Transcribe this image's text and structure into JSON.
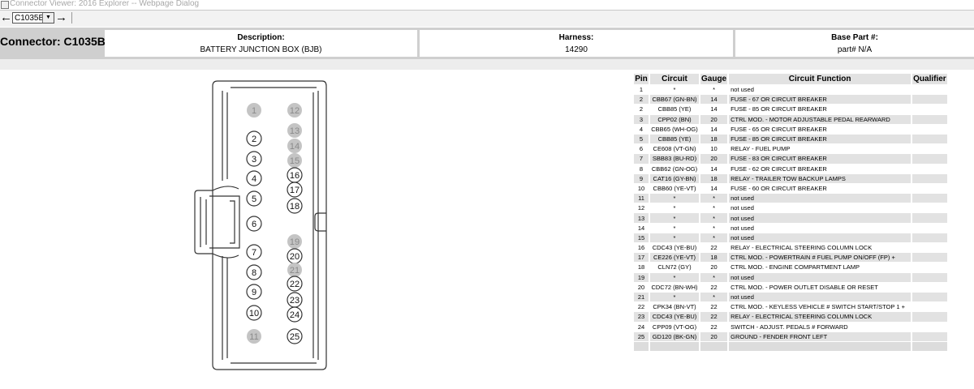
{
  "window": {
    "title": "Connector Viewer: 2016 Explorer -- Webpage Dialog"
  },
  "nav": {
    "back_icon": "←",
    "forward_icon": "→",
    "selected_connector": "C1035B",
    "dropdown_icon": "▼"
  },
  "header": {
    "connector_label": "Connector: C1035B",
    "description_label": "Description:",
    "description_value": "BATTERY JUNCTION BOX (BJB)",
    "harness_label": "Harness:",
    "harness_value": "14290",
    "base_part_label": "Base Part #:",
    "base_part_value": "part# N/A"
  },
  "diagram": {
    "pins": [
      {
        "n": "1",
        "used": false
      },
      {
        "n": "2",
        "used": true
      },
      {
        "n": "3",
        "used": true
      },
      {
        "n": "4",
        "used": true
      },
      {
        "n": "5",
        "used": true
      },
      {
        "n": "6",
        "used": true
      },
      {
        "n": "7",
        "used": true
      },
      {
        "n": "8",
        "used": true
      },
      {
        "n": "9",
        "used": true
      },
      {
        "n": "10",
        "used": true
      },
      {
        "n": "11",
        "used": false
      },
      {
        "n": "12",
        "used": false
      },
      {
        "n": "13",
        "used": false
      },
      {
        "n": "14",
        "used": false
      },
      {
        "n": "15",
        "used": false
      },
      {
        "n": "16",
        "used": true
      },
      {
        "n": "17",
        "used": true
      },
      {
        "n": "18",
        "used": true
      },
      {
        "n": "19",
        "used": false
      },
      {
        "n": "20",
        "used": true
      },
      {
        "n": "21",
        "used": false
      },
      {
        "n": "22",
        "used": true
      },
      {
        "n": "23",
        "used": true
      },
      {
        "n": "24",
        "used": true
      },
      {
        "n": "25",
        "used": true
      }
    ],
    "colors": {
      "unused_fill": "#c4c4c4",
      "used_fill": "#ffffff",
      "outline": "#333333"
    }
  },
  "table": {
    "headers": [
      "Pin",
      "Circuit",
      "Gauge",
      "Circuit Function",
      "Qualifier"
    ],
    "rows": [
      [
        "1",
        "*",
        "*",
        "not used",
        ""
      ],
      [
        "2",
        "CBB67 (GN-BN)",
        "14",
        "FUSE - 67 OR CIRCUIT BREAKER",
        ""
      ],
      [
        "2",
        "CBB85 (YE)",
        "14",
        "FUSE - 85 OR CIRCUIT BREAKER",
        ""
      ],
      [
        "3",
        "CPP02 (BN)",
        "20",
        "CTRL MOD. - MOTOR ADJUSTABLE PEDAL REARWARD",
        ""
      ],
      [
        "4",
        "CBB65 (WH-OG)",
        "14",
        "FUSE - 65 OR CIRCUIT BREAKER",
        ""
      ],
      [
        "5",
        "CBB85 (YE)",
        "18",
        "FUSE - 85 OR CIRCUIT BREAKER",
        ""
      ],
      [
        "6",
        "CE608 (VT-GN)",
        "10",
        "RELAY - FUEL PUMP",
        ""
      ],
      [
        "7",
        "SBB83 (BU-RD)",
        "20",
        "FUSE - 83 OR CIRCUIT BREAKER",
        ""
      ],
      [
        "8",
        "CBB62 (GN-OG)",
        "14",
        "FUSE - 62 OR CIRCUIT BREAKER",
        ""
      ],
      [
        "9",
        "CAT16 (GY-BN)",
        "18",
        "RELAY - TRAILER TOW BACKUP LAMPS",
        ""
      ],
      [
        "10",
        "CBB60 (YE-VT)",
        "14",
        "FUSE - 60 OR CIRCUIT BREAKER",
        ""
      ],
      [
        "11",
        "*",
        "*",
        "not used",
        ""
      ],
      [
        "12",
        "*",
        "*",
        "not used",
        ""
      ],
      [
        "13",
        "*",
        "*",
        "not used",
        ""
      ],
      [
        "14",
        "*",
        "*",
        "not used",
        ""
      ],
      [
        "15",
        "*",
        "*",
        "not used",
        ""
      ],
      [
        "16",
        "CDC43 (YE-BU)",
        "22",
        "RELAY - ELECTRICAL STEERING COLUMN LOCK",
        ""
      ],
      [
        "17",
        "CE226 (YE-VT)",
        "18",
        "CTRL MOD. - POWERTRAIN # FUEL PUMP ON/OFF (FP) +",
        ""
      ],
      [
        "18",
        "CLN72 (GY)",
        "20",
        "CTRL MOD. - ENGINE COMPARTMENT LAMP",
        ""
      ],
      [
        "19",
        "*",
        "*",
        "not used",
        ""
      ],
      [
        "20",
        "CDC72 (BN-WH)",
        "22",
        "CTRL MOD. - POWER OUTLET DISABLE OR RESET",
        ""
      ],
      [
        "21",
        "*",
        "*",
        "not used",
        ""
      ],
      [
        "22",
        "CPK34 (BN-VT)",
        "22",
        "CTRL MOD. - KEYLESS VEHICLE # SWITCH START/STOP 1 +",
        ""
      ],
      [
        "23",
        "CDC43 (YE-BU)",
        "22",
        "RELAY - ELECTRICAL STEERING COLUMN LOCK",
        ""
      ],
      [
        "24",
        "CPP09 (VT-OG)",
        "22",
        "SWITCH - ADJUST. PEDALS # FORWARD",
        ""
      ],
      [
        "25",
        "GD120 (BK-GN)",
        "20",
        "GROUND - FENDER FRONT LEFT",
        ""
      ]
    ]
  }
}
